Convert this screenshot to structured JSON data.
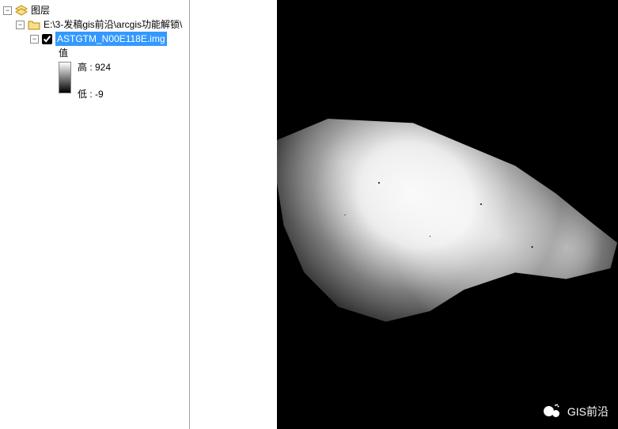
{
  "toc": {
    "root_label": "图层",
    "group_label": "E:\\3-发稿gis前沿\\arcgis功能解锁\\",
    "layer_label": "ASTGTM_N00E118E.img",
    "value_label": "值",
    "high_label": "高 : 924",
    "low_label": "低 : -9",
    "layer_checked": true
  },
  "watermark": {
    "text": "GIS前沿"
  },
  "chart_data": {
    "type": "raster-dem",
    "name": "ASTGTM_N00E118E.img",
    "value_field": "值",
    "stats": {
      "max": 924,
      "min": -9
    },
    "colormap": "grayscale (white=high, black=low)"
  }
}
